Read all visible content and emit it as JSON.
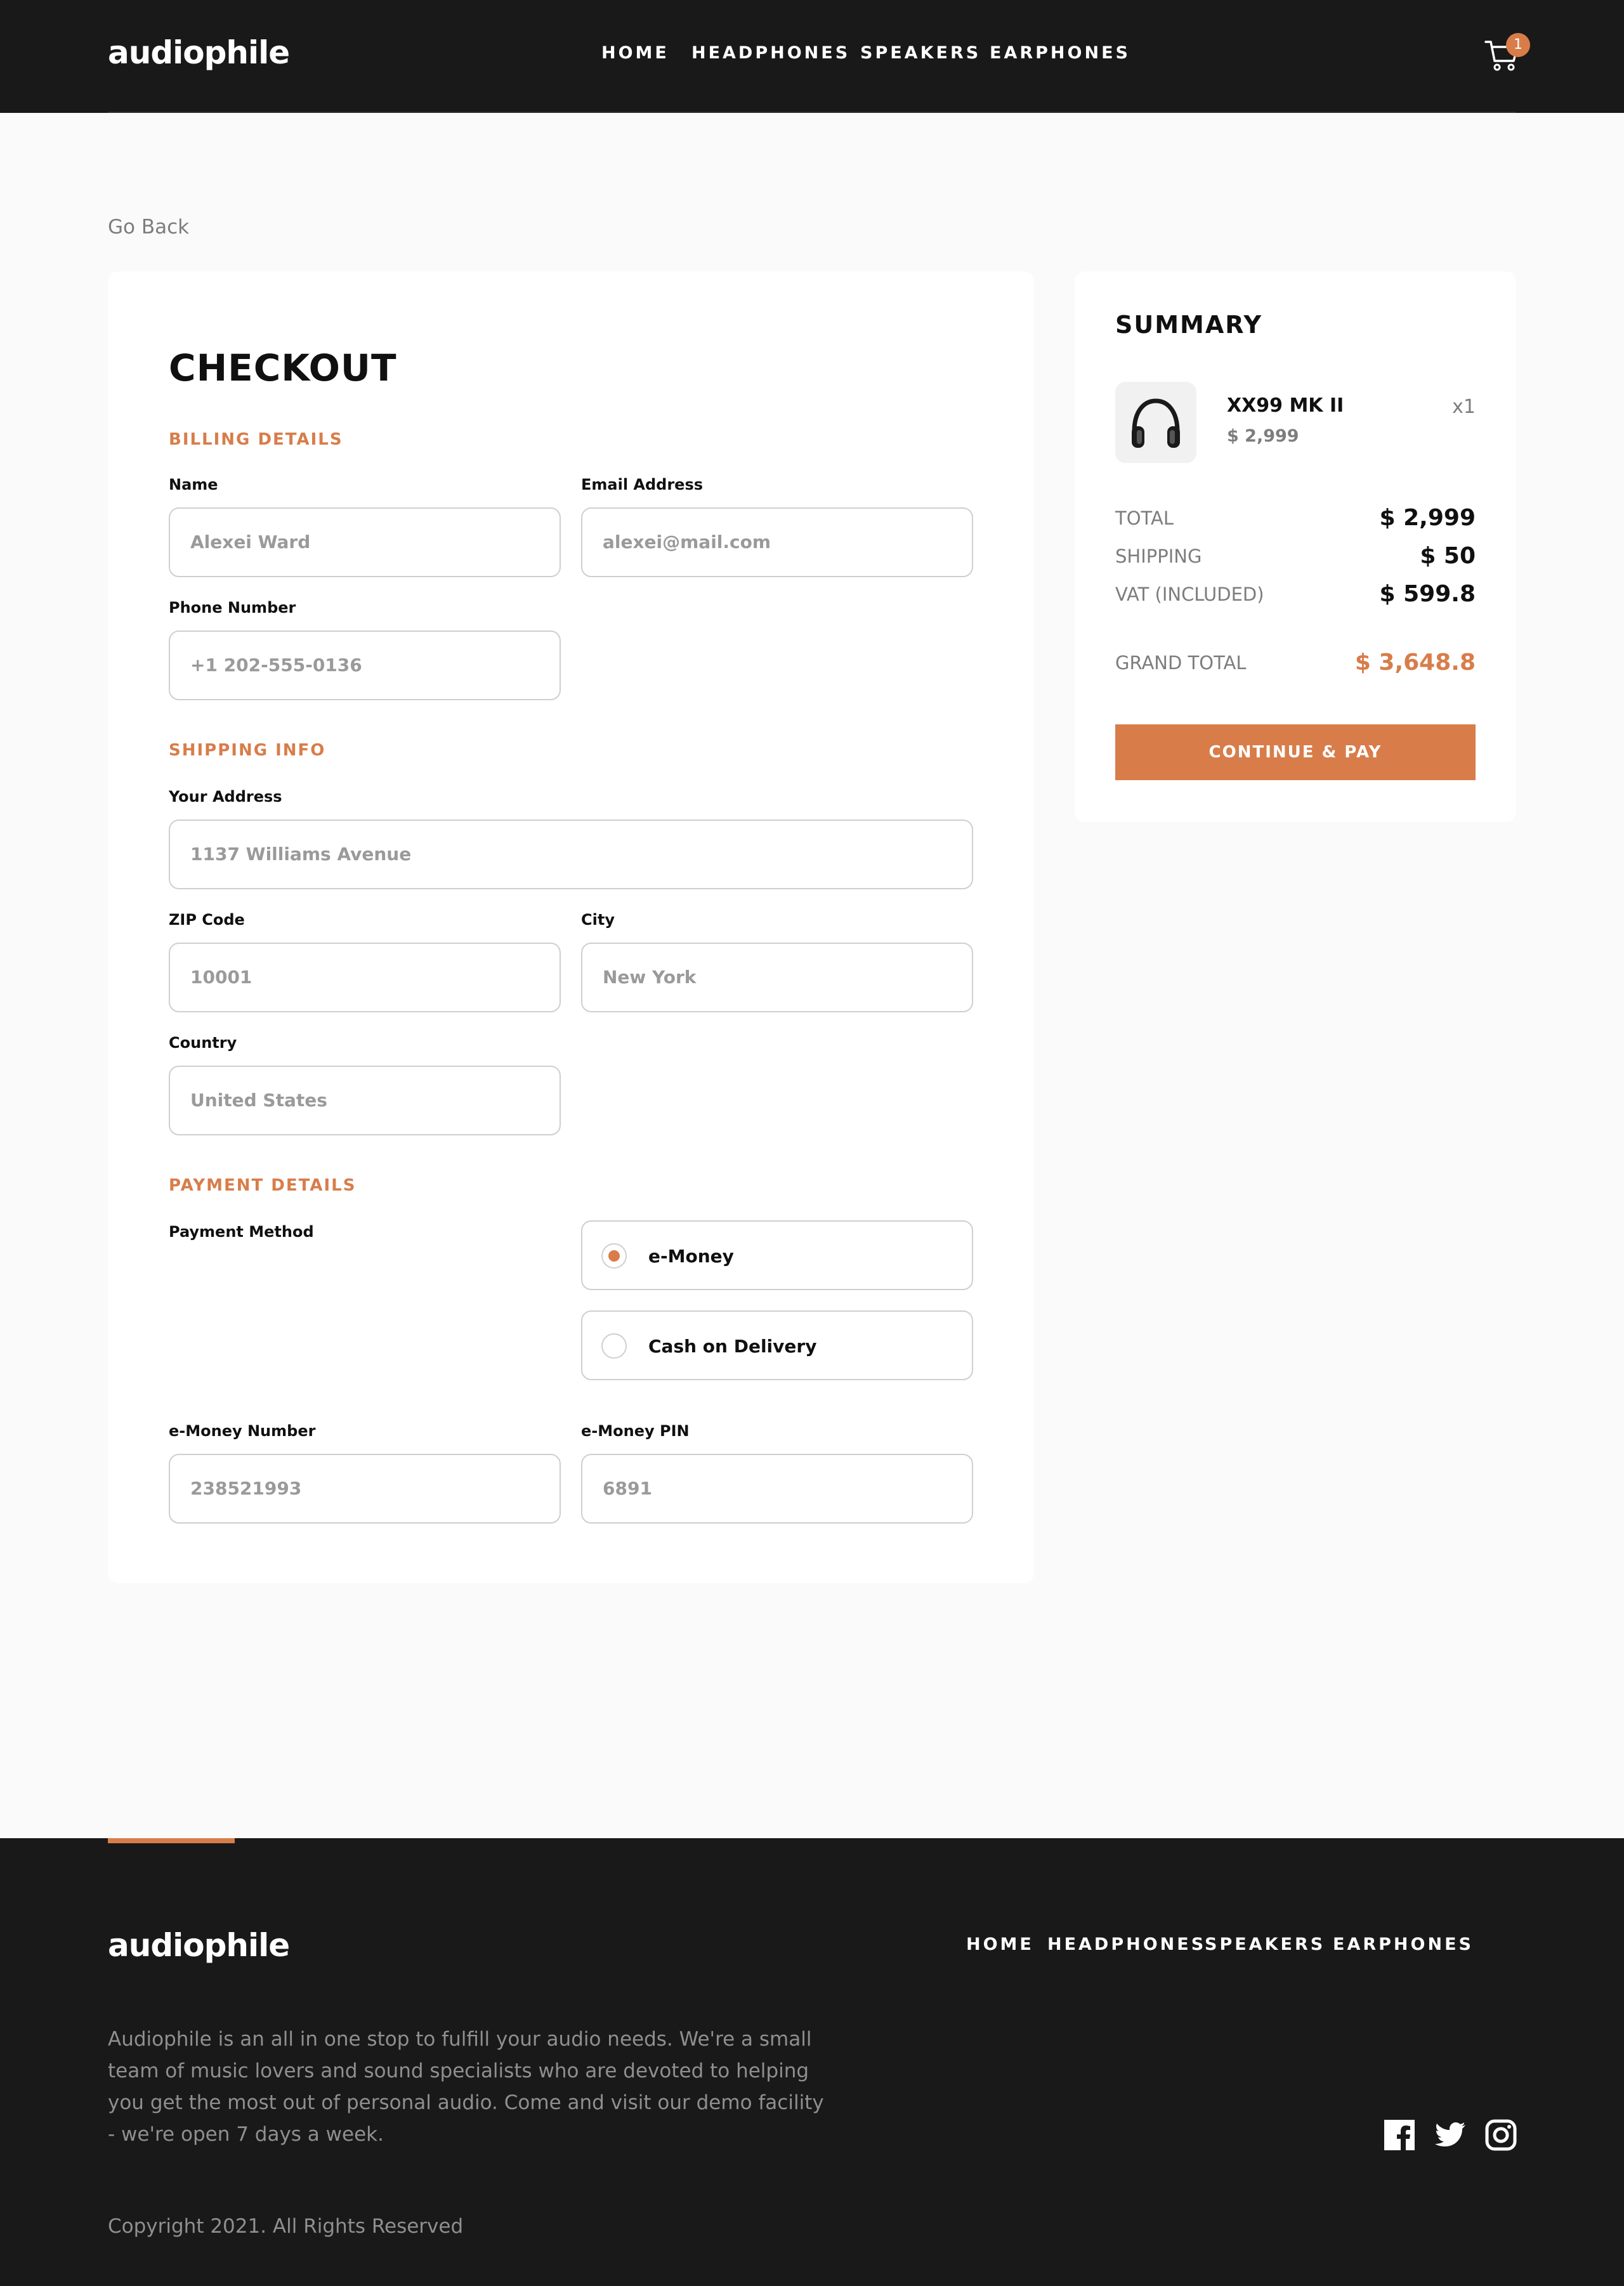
{
  "header": {
    "logo": "audiophile",
    "nav": [
      "HOME",
      "HEADPHONES",
      "SPEAKERS",
      "EARPHONES"
    ],
    "cart_count": "1"
  },
  "go_back": "Go Back",
  "checkout": {
    "title": "CHECKOUT",
    "billing_title": "BILLING DETAILS",
    "shipping_title": "SHIPPING INFO",
    "payment_title": "PAYMENT DETAILS",
    "fields": {
      "name": {
        "label": "Name",
        "placeholder": "Alexei Ward"
      },
      "email": {
        "label": "Email Address",
        "placeholder": "alexei@mail.com"
      },
      "phone": {
        "label": "Phone Number",
        "placeholder": "+1 202-555-0136"
      },
      "address": {
        "label": "Your Address",
        "placeholder": "1137 Williams Avenue"
      },
      "zip": {
        "label": "ZIP Code",
        "placeholder": "10001"
      },
      "city": {
        "label": "City",
        "placeholder": "New York"
      },
      "country": {
        "label": "Country",
        "placeholder": "United States"
      },
      "emoney_number": {
        "label": "e-Money Number",
        "placeholder": "238521993"
      },
      "emoney_pin": {
        "label": "e-Money PIN",
        "placeholder": "6891"
      }
    },
    "payment_method_label": "Payment Method",
    "payment_options": [
      {
        "label": "e-Money",
        "selected": true
      },
      {
        "label": "Cash on Delivery",
        "selected": false
      }
    ]
  },
  "summary": {
    "title": "SUMMARY",
    "item": {
      "name": "XX99 MK II",
      "price": "$ 2,999",
      "qty": "x1",
      "icon": "headphones-icon"
    },
    "rows": [
      {
        "label": "TOTAL",
        "value": "$ 2,999"
      },
      {
        "label": "SHIPPING",
        "value": "$ 50"
      },
      {
        "label": "VAT (INCLUDED)",
        "value": "$ 599.8"
      }
    ],
    "grand_total_label": "GRAND TOTAL",
    "grand_total_value": "$ 3,648.8",
    "pay_button": "CONTINUE & PAY"
  },
  "footer": {
    "logo": "audiophile",
    "nav": [
      "HOME",
      "HEADPHONES",
      "SPEAKERS",
      "EARPHONES"
    ],
    "description": "Audiophile is an all in one stop to fulfill your audio needs. We're a small team of music lovers and sound specialists who are devoted to helping you get the most out of personal audio. Come and visit our demo facility - we're open 7 days a week.",
    "copyright": "Copyright 2021. All Rights Reserved",
    "social": [
      "facebook-icon",
      "twitter-icon",
      "instagram-icon"
    ]
  },
  "colors": {
    "accent": "#d87d4a",
    "dark": "#191919",
    "background": "#fafafa"
  }
}
